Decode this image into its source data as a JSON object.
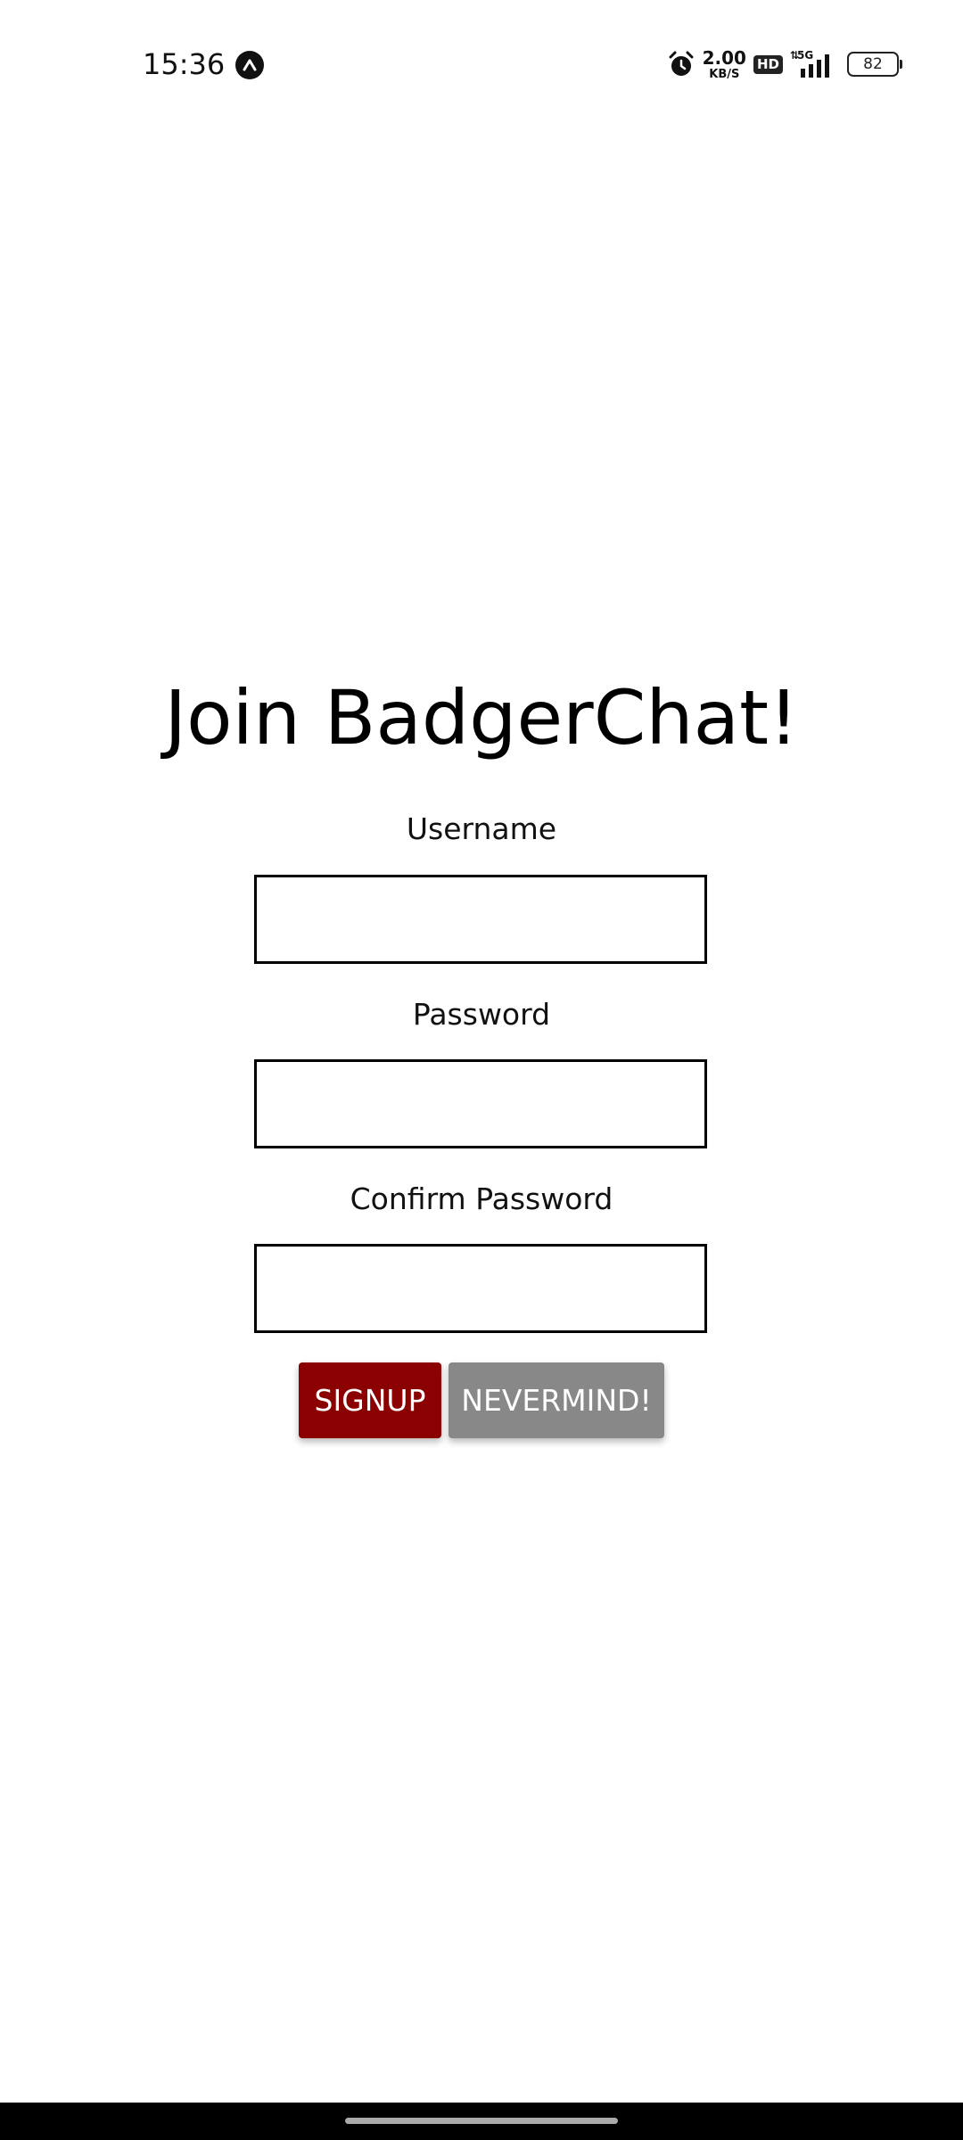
{
  "status_bar": {
    "time": "15:36",
    "net_speed_value": "2.00",
    "net_speed_unit": "KB/S",
    "hd_label": "HD",
    "network_label": "5G",
    "battery_level": "82"
  },
  "signup_form": {
    "title": "Join BadgerChat!",
    "username_label": "Username",
    "username_value": "",
    "password_label": "Password",
    "password_value": "",
    "confirm_password_label": "Confirm Password",
    "confirm_password_value": "",
    "signup_label": "SIGNUP",
    "nevermind_label": "NEVERMIND!"
  },
  "colors": {
    "signup_button": "#8b0000",
    "nevermind_button": "#888888"
  }
}
